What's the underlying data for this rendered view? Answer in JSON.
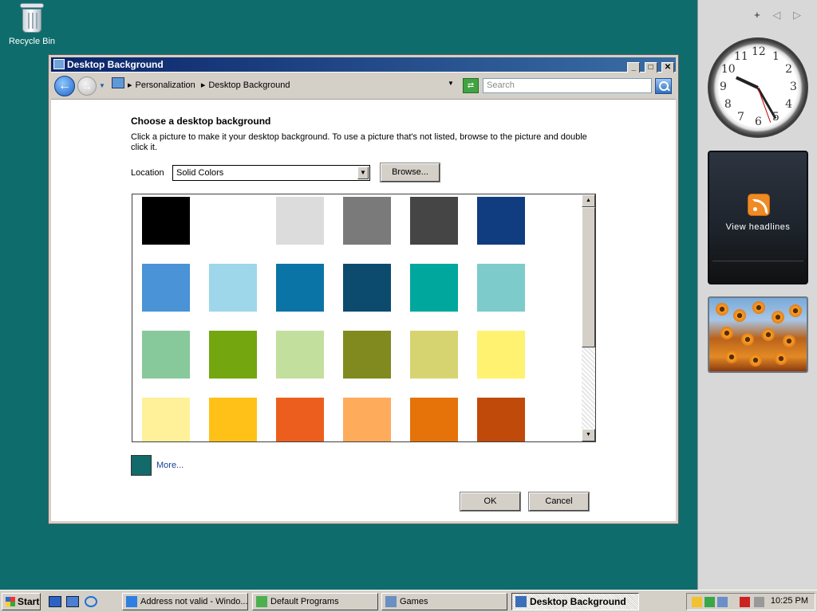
{
  "desktop": {
    "recycle_bin_label": "Recycle Bin",
    "background_color": "#0f6c6c"
  },
  "window": {
    "title": "Desktop Background",
    "controls": {
      "minimize": "_",
      "maximize": "□",
      "close": "✕"
    },
    "breadcrumbs": [
      "Personalization",
      "Desktop Background"
    ],
    "search_placeholder": "Search",
    "heading": "Choose a desktop background",
    "description": "Click a picture to make it your desktop background. To use a picture that's not listed, browse to the picture and double click it.",
    "location_label": "Location",
    "location_value": "Solid Colors",
    "browse_label": "Browse...",
    "swatches": [
      [
        "#000000",
        "#ffffff",
        "#dcdcdc",
        "#7a7a7a",
        "#454545",
        "#0f3d7f"
      ],
      [
        "#4a93d6",
        "#9ed6ea",
        "#0a74a6",
        "#0c4b6e",
        "#00a79d",
        "#7dcbcb"
      ],
      [
        "#88c99b",
        "#73a60f",
        "#c3df9d",
        "#818a1e",
        "#d6d470",
        "#fff270"
      ],
      [
        "#fff09a",
        "#ffc117",
        "#ec5e1d",
        "#ffab5c",
        "#e57309",
        "#c04a0a"
      ]
    ],
    "more_label": "More...",
    "more_color": "#136a6a",
    "ok_label": "OK",
    "cancel_label": "Cancel"
  },
  "sidebar": {
    "tools": {
      "add": "+",
      "prev": "◁",
      "next": "▷"
    },
    "clock_numbers": [
      "12",
      "1",
      "2",
      "3",
      "4",
      "5",
      "6",
      "7",
      "8",
      "9",
      "10",
      "11"
    ],
    "headlines_label": "View headlines"
  },
  "taskbar": {
    "start_label": "Start",
    "tasks": [
      {
        "label": "Address not valid - Windo...",
        "icon": "ie-icon"
      },
      {
        "label": "Default Programs",
        "icon": "default-programs-icon"
      },
      {
        "label": "Games",
        "icon": "games-icon"
      },
      {
        "label": "Desktop Background",
        "icon": "personalization-icon",
        "active": true
      }
    ],
    "time": "10:25 PM"
  }
}
